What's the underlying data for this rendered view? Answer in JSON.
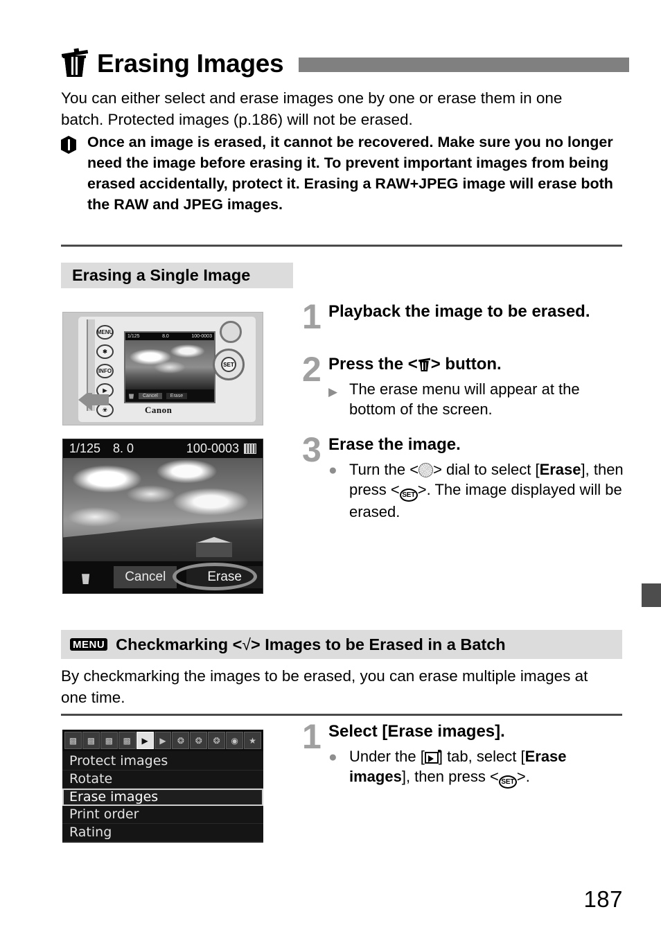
{
  "page": {
    "number": "187",
    "title": "Erasing Images",
    "title_icon": "trash-icon"
  },
  "intro": "You can either select and erase images one by one or erase them in one batch. Protected images (p.186) will not be erased.",
  "warning": {
    "icon": "caution-icon",
    "text": "Once an image is erased, it cannot be recovered. Make sure you no longer need the image before erasing it. To prevent important images from being erased accidentally, protect it. Erasing a RAW+JPEG image will erase both the RAW and JPEG images."
  },
  "section_single": {
    "heading": "Erasing a Single Image",
    "steps": [
      {
        "number": "1",
        "title": "Playback the image to be erased."
      },
      {
        "number": "2",
        "title_pre": "Press the <",
        "title_icon": "trash-icon",
        "title_post": "> button.",
        "bullet_mark": "▶",
        "bullet": "The erase menu will appear at the bottom of the screen."
      },
      {
        "number": "3",
        "title": "Erase the image.",
        "bullet_mark": "●",
        "bullet_a": "Turn the <",
        "bullet_icon_dial": "quick-control-dial-icon",
        "bullet_b": "> dial to select [",
        "bullet_strong": "Erase",
        "bullet_c": "], then press <",
        "bullet_icon_set": "set-button-icon",
        "bullet_d": ">. The image displayed will be erased."
      }
    ]
  },
  "camera_illustration": {
    "brand": "Canon",
    "buttons": [
      "MENU",
      "✱",
      "INFO.",
      "▶",
      "ᵛ"
    ],
    "lcd": {
      "shutter": "1/125",
      "aperture": "8.0",
      "file": "100-0003",
      "cancel": "Cancel",
      "erase": "Erase"
    }
  },
  "lcd_screenshot": {
    "shutter": "1/125",
    "aperture": "8. 0",
    "file_number": "100-0003",
    "card_icon": "card-icon",
    "trash_icon": "trash-icon",
    "cancel_label": "Cancel",
    "erase_label": "Erase",
    "highlighted": "Erase"
  },
  "section_batch": {
    "menu_badge": "MENU",
    "heading_pre": "Checkmarking <",
    "heading_check": "√",
    "heading_post": "> Images to be Erased in a Batch",
    "intro": "By checkmarking the images to be erased, you can erase multiple images at one time.",
    "steps": [
      {
        "number": "1",
        "title": "Select [Erase images].",
        "bullet_mark": "●",
        "bullet_a": "Under the [",
        "bullet_icon_tab": "playback-tab-icon",
        "bullet_b": "] tab, select [",
        "bullet_strong": "Erase images",
        "bullet_c": "], then press <",
        "bullet_icon_set": "set-button-icon",
        "bullet_d": ">."
      }
    ]
  },
  "menu_screenshot": {
    "tabs": [
      "▣",
      "▣",
      "▣",
      "▣",
      "▶",
      "▶",
      "⚙",
      "⚙",
      "⚙",
      "◉",
      "★"
    ],
    "active_tab_index": 4,
    "rows": [
      "Protect images",
      "Rotate",
      "Erase images",
      "Print order",
      "Rating"
    ],
    "selected_row": "Erase images"
  },
  "colors": {
    "title_bar": "#808080",
    "band_bg": "#dcdcdc",
    "step_number": "#a0a0a0",
    "rule": "#4a4a4a",
    "side_tab": "#4d4d4d"
  }
}
